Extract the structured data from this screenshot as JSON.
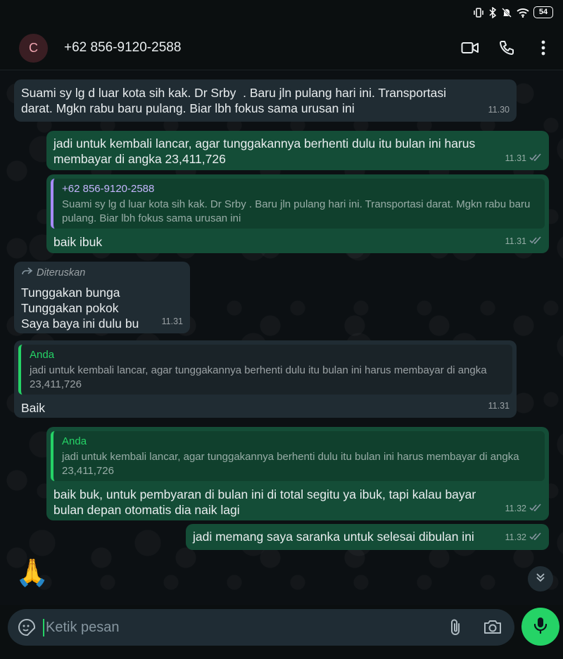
{
  "status_bar": {
    "battery": "54"
  },
  "header": {
    "avatar_letter": "C",
    "contact": "+62 856-9120-2588"
  },
  "messages": [
    {
      "dir": "in",
      "text": "Suami sy lg d luar kota sih kak. Dr Srby  . Baru jln pulang hari ini. Transportasi\ndarat. Mgkn rabu baru pulang. Biar lbh fokus sama urusan ini",
      "time": "11.30"
    },
    {
      "dir": "out",
      "text": "jadi untuk kembali lancar, agar tunggakannya berhenti dulu itu bulan ini harus\nmembayar di angka 23,411,726",
      "time": "11.31"
    },
    {
      "dir": "out",
      "quote_author": "+62 856-9120-2588",
      "quote_text": "Suami sy lg d luar kota sih kak. Dr Srby  . Baru jln pulang hari ini. Transportasi darat. Mgkn rabu baru pulang. Biar lbh fokus sama urusan ini",
      "text": "baik ibuk",
      "time": "11.31"
    },
    {
      "dir": "in",
      "forwarded_label": "Diteruskan",
      "text": "Tunggakan bunga\nTunggakan pokok\nSaya baya ini dulu bu",
      "time": "11.31"
    },
    {
      "dir": "in",
      "quote_author": "Anda",
      "quote_text": "jadi untuk kembali lancar, agar tunggakannya berhenti dulu itu bulan ini harus membayar di angka 23,411,726",
      "text": "Baik",
      "time": "11.31"
    },
    {
      "dir": "out",
      "quote_author": "Anda",
      "quote_text": "jadi untuk kembali lancar, agar tunggakannya berhenti dulu itu bulan ini harus membayar di angka 23,411,726",
      "text": "baik buk, untuk pembyaran di bulan ini di total segitu ya ibuk, tapi kalau bayar\nbulan depan otomatis dia naik lagi",
      "time": "11.32"
    },
    {
      "dir": "out",
      "text": "jadi memang saya saranka untuk selesai dibulan ini",
      "time": "11.32"
    }
  ],
  "draft_emoji": "🙏",
  "composer": {
    "placeholder": "Ketik pesan"
  },
  "colors": {
    "accent": "#25d366",
    "outgoing_bubble": "#144d37",
    "incoming_bubble": "#202c33",
    "quote_bar_contact": "#a78bfa",
    "quote_bar_self": "#25d366",
    "read_ticks": "#8696a0"
  },
  "icons": [
    "wifi-icon",
    "bluetooth-icon",
    "vibrate-icon",
    "mute-icon",
    "video-call-icon",
    "phone-icon",
    "more-vert-icon",
    "forward-icon",
    "double-check-icon",
    "scroll-down-icon",
    "sticker-icon",
    "attach-icon",
    "camera-icon",
    "mic-icon"
  ]
}
